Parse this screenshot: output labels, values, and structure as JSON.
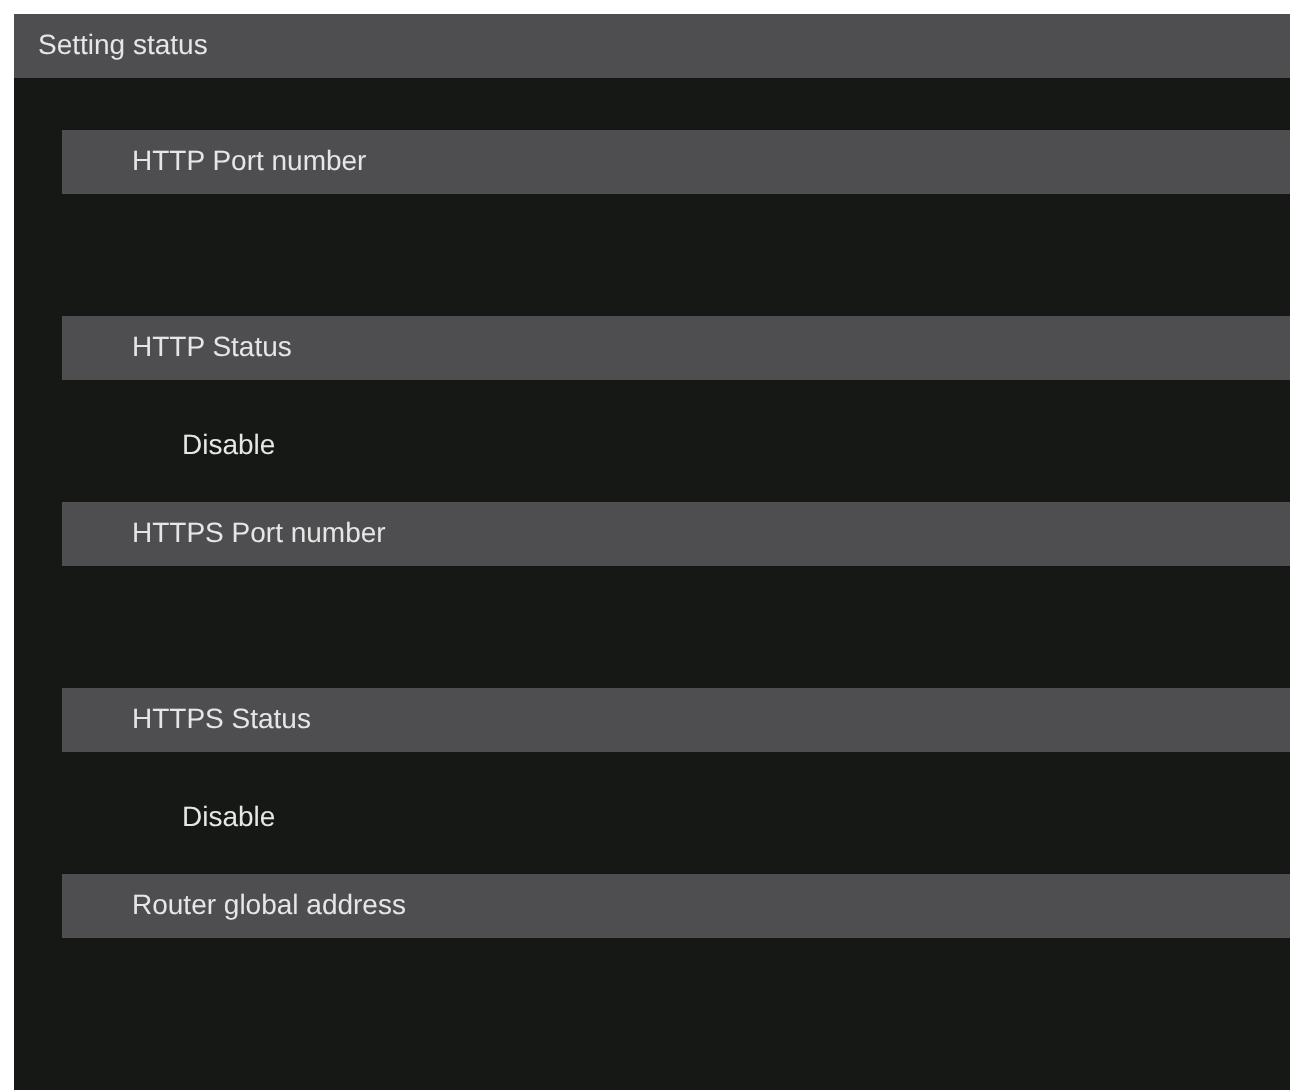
{
  "panel": {
    "title": "Setting status"
  },
  "sections": [
    {
      "title": "HTTP Port number"
    },
    {
      "title": "HTTP Status",
      "value": "Disable"
    },
    {
      "title": "HTTPS Port number"
    },
    {
      "title": "HTTPS Status",
      "value": "Disable"
    },
    {
      "title": "Router global address"
    }
  ]
}
